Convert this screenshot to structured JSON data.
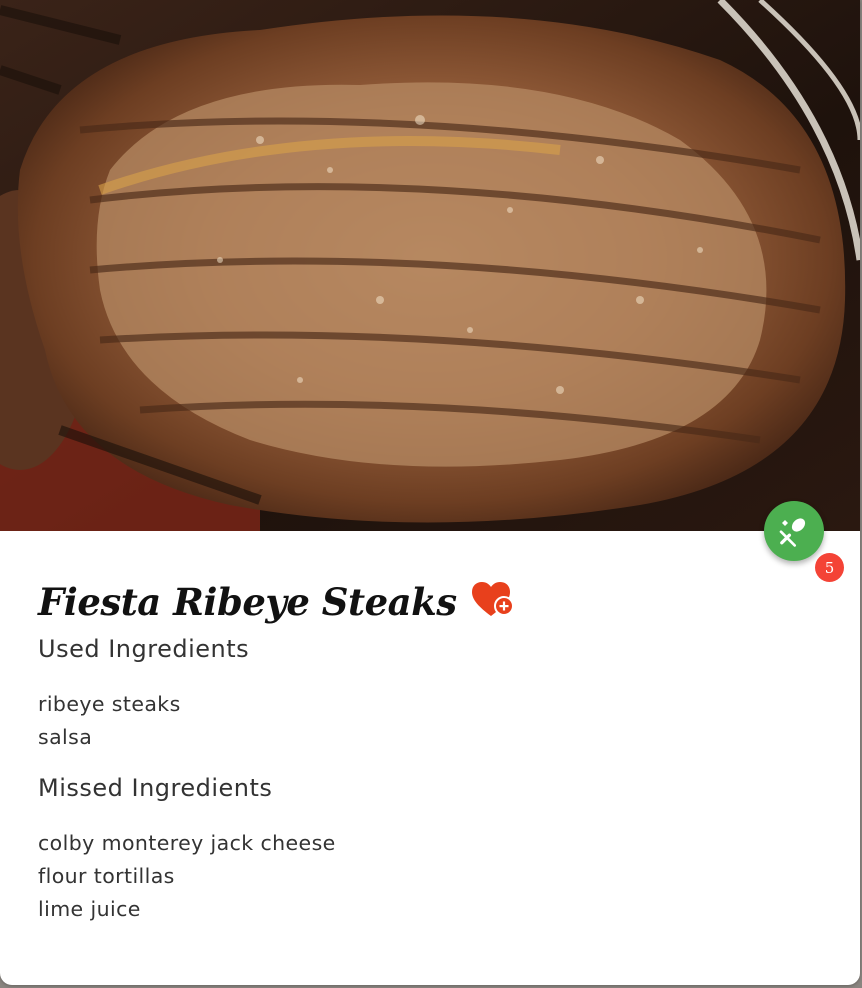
{
  "recipe": {
    "title": "Fiesta Ribeye Steaks",
    "used_heading": "Used Ingredients",
    "used_ingredients": [
      "ribeye steaks",
      "salsa"
    ],
    "missed_heading": "Missed Ingredients",
    "missed_ingredients": [
      "colby monterey jack cheese",
      "flour tortillas",
      "lime juice"
    ],
    "missed_count": "5"
  },
  "icons": {
    "fab": "utensils-icon",
    "favorite": "heart-plus-icon"
  },
  "colors": {
    "fab": "#4caf50",
    "badge": "#f44336",
    "heart": "#e8401c"
  }
}
